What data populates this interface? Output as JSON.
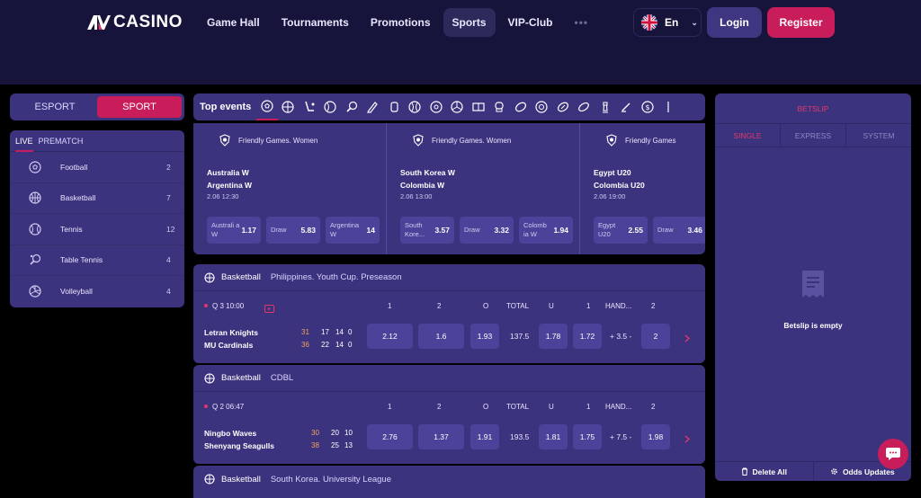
{
  "brand": {
    "logo_text": "CASINO"
  },
  "nav": {
    "items": [
      {
        "label": "Game Hall"
      },
      {
        "label": "Tournaments"
      },
      {
        "label": "Promotions"
      },
      {
        "label": "Sports"
      },
      {
        "label": "VIP-Club"
      }
    ],
    "more": "•••",
    "active": "Sports"
  },
  "header": {
    "language": "En",
    "login_label": "Login",
    "register_label": "Register"
  },
  "mode_switch": {
    "esport": "ESPORT",
    "sport": "SPORT",
    "active": "SPORT"
  },
  "sports_panel": {
    "tabs": [
      "LIVE",
      "PREMATCH"
    ],
    "active_tab": "LIVE",
    "items": [
      {
        "name": "Football",
        "count": "2",
        "icon": "football-icon"
      },
      {
        "name": "Basketball",
        "count": "7",
        "icon": "basketball-icon"
      },
      {
        "name": "Tennis",
        "count": "12",
        "icon": "tennis-icon"
      },
      {
        "name": "Table Tennis",
        "count": "4",
        "icon": "table-tennis-icon"
      },
      {
        "name": "Volleyball",
        "count": "4",
        "icon": "volleyball-icon"
      }
    ]
  },
  "top_events": {
    "title": "Top events",
    "events": [
      {
        "league": "Friendly Games. Women",
        "team1": "Australia W",
        "team2": "Argentina W",
        "datetime": "2.06   12:30",
        "odds": [
          {
            "label": "Australi a W",
            "value": "1.17"
          },
          {
            "label": "Draw",
            "value": "5.83"
          },
          {
            "label": "Argentina W",
            "value": "14"
          }
        ]
      },
      {
        "league": "Friendly Games. Women",
        "team1": "South Korea W",
        "team2": "Colombia W",
        "datetime": "2.06   13:00",
        "odds": [
          {
            "label": "South Kore...",
            "value": "3.57"
          },
          {
            "label": "Draw",
            "value": "3.32"
          },
          {
            "label": "Colomb ia W",
            "value": "1.94"
          }
        ]
      },
      {
        "league": "Friendly Games",
        "team1": "Egypt U20",
        "team2": "Colombia U20",
        "datetime": "2.06   19:00",
        "odds": [
          {
            "label": "Egypt U20",
            "value": "2.55"
          },
          {
            "label": "Draw",
            "value": "3.46"
          }
        ]
      }
    ]
  },
  "matches": [
    {
      "sport": "Basketball",
      "league": "Philippines. Youth Cup. Preseason",
      "period": "Q 3  10:00",
      "team1": "Letran Knights",
      "team2": "MU Cardinals",
      "score1": [
        "31",
        "17",
        "14",
        "0"
      ],
      "score2": [
        "36",
        "22",
        "14",
        "0"
      ],
      "columns": [
        "1",
        "2",
        "O",
        "TOTAL",
        "U",
        "1",
        "HAND...",
        "2"
      ],
      "odds": {
        "w1": "2.12",
        "w2": "1.6",
        "over": "1.93",
        "total": "137.5",
        "under": "1.78",
        "h1": "1.72",
        "handicap": "+ 3.5 -",
        "h2": "2"
      }
    },
    {
      "sport": "Basketball",
      "league": "CDBL",
      "period": "Q 2  06:47",
      "team1": "Ningbo Waves",
      "team2": "Shenyang Seagulls",
      "score1": [
        "30",
        "20",
        "10"
      ],
      "score2": [
        "38",
        "25",
        "13"
      ],
      "columns": [
        "1",
        "2",
        "O",
        "TOTAL",
        "U",
        "1",
        "HAND...",
        "2"
      ],
      "odds": {
        "w1": "2.76",
        "w2": "1.37",
        "over": "1.91",
        "total": "193.5",
        "under": "1.81",
        "h1": "1.75",
        "handicap": "+ 7.5 -",
        "h2": "1.98"
      }
    },
    {
      "sport": "Basketball",
      "league": "South Korea. University League"
    }
  ],
  "betslip": {
    "title": "BETSLIP",
    "tabs": [
      "SINGLE",
      "EXPRESS",
      "SYSTEM"
    ],
    "active_tab": "SINGLE",
    "empty_text": "Betslip is empty",
    "delete_all": "Delete All",
    "odds_updates": "Odds Updates"
  },
  "colors": {
    "accent": "#c81d5a",
    "panel": "#3b337e",
    "header": "#16143a"
  }
}
